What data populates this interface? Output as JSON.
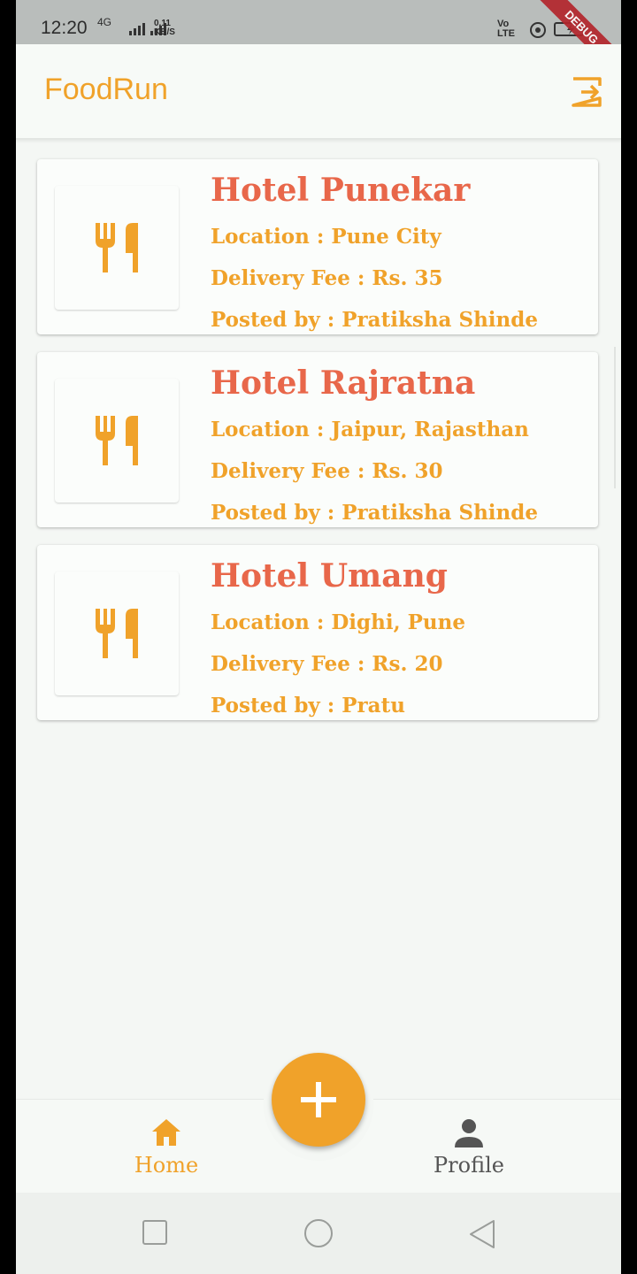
{
  "status_bar": {
    "time": "12:20",
    "signal_label": "4G",
    "speed_value": "0.11",
    "speed_unit": "KB/S",
    "volte_top": "Vo",
    "volte_bottom": "LTE",
    "debug_label": "DEBUG"
  },
  "app_bar": {
    "title": "FoodRun",
    "logout_icon": "logout-icon"
  },
  "listings": [
    {
      "name": "Hotel Punekar",
      "location": "Location : Pune City",
      "delivery_fee": "Delivery Fee : Rs. 35",
      "posted_by": "Posted by : Pratiksha Shinde",
      "icon": "restaurant-icon"
    },
    {
      "name": "Hotel Rajratna",
      "location": "Location : Jaipur, Rajasthan",
      "delivery_fee": "Delivery Fee : Rs. 30",
      "posted_by": "Posted by : Pratiksha Shinde",
      "icon": "restaurant-icon"
    },
    {
      "name": "Hotel Umang",
      "location": "Location : Dighi, Pune",
      "delivery_fee": "Delivery Fee : Rs. 20",
      "posted_by": "Posted by : Pratu",
      "icon": "restaurant-icon"
    }
  ],
  "fab": {
    "icon": "plus-icon"
  },
  "bottom_nav": {
    "items": [
      {
        "label": "Home",
        "icon": "home-icon",
        "active": true
      },
      {
        "label": "Profile",
        "icon": "person-icon",
        "active": false
      }
    ]
  },
  "colors": {
    "accent": "#f0a22a",
    "title_red": "#e8674a",
    "background": "#f4f7f4"
  }
}
